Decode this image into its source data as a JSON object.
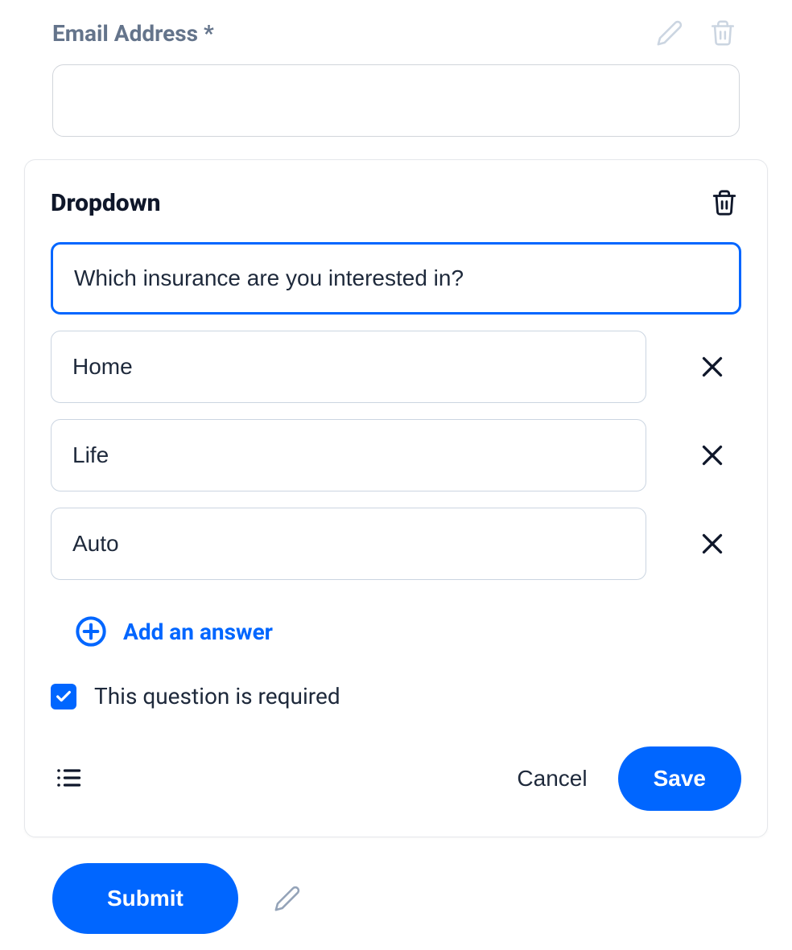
{
  "email": {
    "label": "Email Address *",
    "value": ""
  },
  "card": {
    "title": "Dropdown",
    "question_value": "Which insurance are you interested in?",
    "options": [
      {
        "value": "Home"
      },
      {
        "value": "Life"
      },
      {
        "value": "Auto"
      }
    ],
    "add_answer_label": "Add an answer",
    "required_label": "This question is required",
    "required_checked": true,
    "cancel_label": "Cancel",
    "save_label": "Save"
  },
  "submit": {
    "label": "Submit"
  }
}
